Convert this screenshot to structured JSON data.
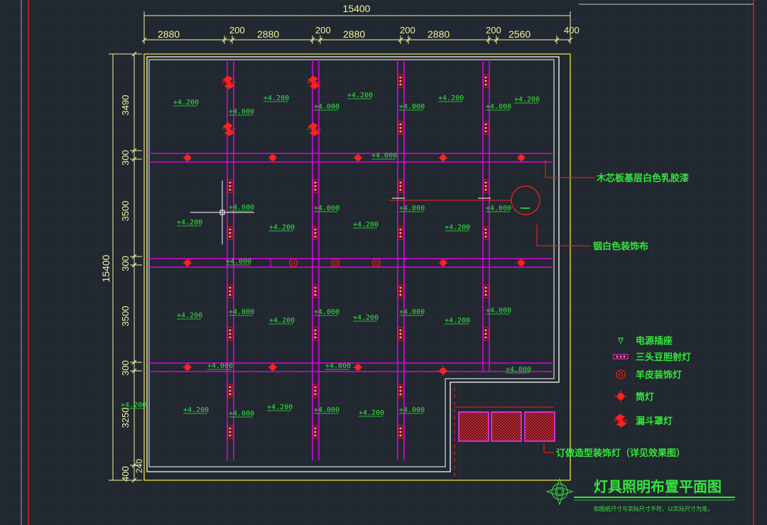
{
  "colors": {
    "background": "#212830",
    "grid": "#2b323b",
    "beam": "#e000e0",
    "dimension": "#f5f2a0",
    "outline": "#ffffff",
    "text": "#33e63b",
    "fixture": "#ff2020",
    "cursor": "#ffffff"
  },
  "dimensions": {
    "top_total": "15400",
    "top_segments": [
      "2880",
      "200",
      "2880",
      "200",
      "2880",
      "200",
      "2880",
      "200",
      "2560",
      "400"
    ],
    "left_total": "15400",
    "left_segments": [
      "3490",
      "300",
      "3500",
      "300",
      "3500",
      "300",
      "3250",
      "400"
    ],
    "left_inner": "240"
  },
  "elevations": [
    {
      "text": "+4.200",
      "col": 0,
      "row": 0
    },
    {
      "text": "+4.000",
      "col": 1,
      "row": 0
    },
    {
      "text": "+4.200",
      "col": 2,
      "row": 0
    },
    {
      "text": "+4.000",
      "col": 3,
      "row": 0
    },
    {
      "text": "+4.200",
      "col": 4,
      "row": 0
    },
    {
      "text": "+4.000",
      "col": 5,
      "row": 0
    },
    {
      "text": "+4.200",
      "col": 6,
      "row": 0
    },
    {
      "text": "+4.000",
      "col": 7,
      "row": 0
    },
    {
      "text": "+4.200",
      "col": 8,
      "row": 0
    },
    {
      "text": "+4.000",
      "col": 9,
      "row": 1
    },
    {
      "text": "+4.200",
      "col": 0,
      "row": 2
    },
    {
      "text": "+4.000",
      "col": 1,
      "row": 2
    },
    {
      "text": "+4.200",
      "col": 2,
      "row": 2
    },
    {
      "text": "+4.000",
      "col": 3,
      "row": 2
    },
    {
      "text": "+4.200",
      "col": 4,
      "row": 2
    },
    {
      "text": "+4.000",
      "col": 5,
      "row": 2
    },
    {
      "text": "+4.200",
      "col": 6,
      "row": 2
    },
    {
      "text": "+4.000",
      "col": 7,
      "row": 2
    },
    {
      "text": "+4.000",
      "col": 10,
      "row": 3
    },
    {
      "text": "+4.200",
      "col": 0,
      "row": 4
    },
    {
      "text": "+4.000",
      "col": 1,
      "row": 4
    },
    {
      "text": "+4.200",
      "col": 2,
      "row": 4
    },
    {
      "text": "+4.000",
      "col": 3,
      "row": 4
    },
    {
      "text": "+4.200",
      "col": 4,
      "row": 4
    },
    {
      "text": "+4.000",
      "col": 5,
      "row": 4
    },
    {
      "text": "+4.200",
      "col": 6,
      "row": 4
    },
    {
      "text": "+4.000",
      "col": 7,
      "row": 4
    },
    {
      "text": "+4.000",
      "col": 11,
      "row": 5
    },
    {
      "text": "+4.000",
      "col": 12,
      "row": 5
    },
    {
      "text": "+4.000",
      "col": 13,
      "row": 5
    },
    {
      "text": "+4.200",
      "col": 14,
      "row": 6
    },
    {
      "text": "+4.200",
      "col": 0,
      "row": 6
    },
    {
      "text": "+4.000",
      "col": 1,
      "row": 6
    },
    {
      "text": "+4.200",
      "col": 2,
      "row": 6
    },
    {
      "text": "+4.000",
      "col": 3,
      "row": 6
    },
    {
      "text": "+4.200",
      "col": 4,
      "row": 6
    },
    {
      "text": "+4.000",
      "col": 5,
      "row": 6
    }
  ],
  "annotations": {
    "ceiling_material": "木芯板基层白色乳胶漆",
    "fabric": "铟白色装饰布",
    "custom_lamp": "订做造型装饰灯（详见效果图）"
  },
  "legend": [
    {
      "icon": "power-socket-icon",
      "label": "电源插座"
    },
    {
      "icon": "triple-spotlight-icon",
      "label": "三头豆胆射灯"
    },
    {
      "icon": "parchment-lamp-icon",
      "label": "羊皮装饰灯"
    },
    {
      "icon": "downlight-icon",
      "label": "筒灯"
    },
    {
      "icon": "funnel-lamp-icon",
      "label": "漏斗罩灯"
    }
  ],
  "title": {
    "main": "灯具照明布置平面图",
    "note": "如图纸尺寸与实际尺寸不符，以实际尺寸为准。"
  },
  "icons": {
    "compass": "compass-rose-icon",
    "cursor": "crosshair-cursor-icon"
  }
}
